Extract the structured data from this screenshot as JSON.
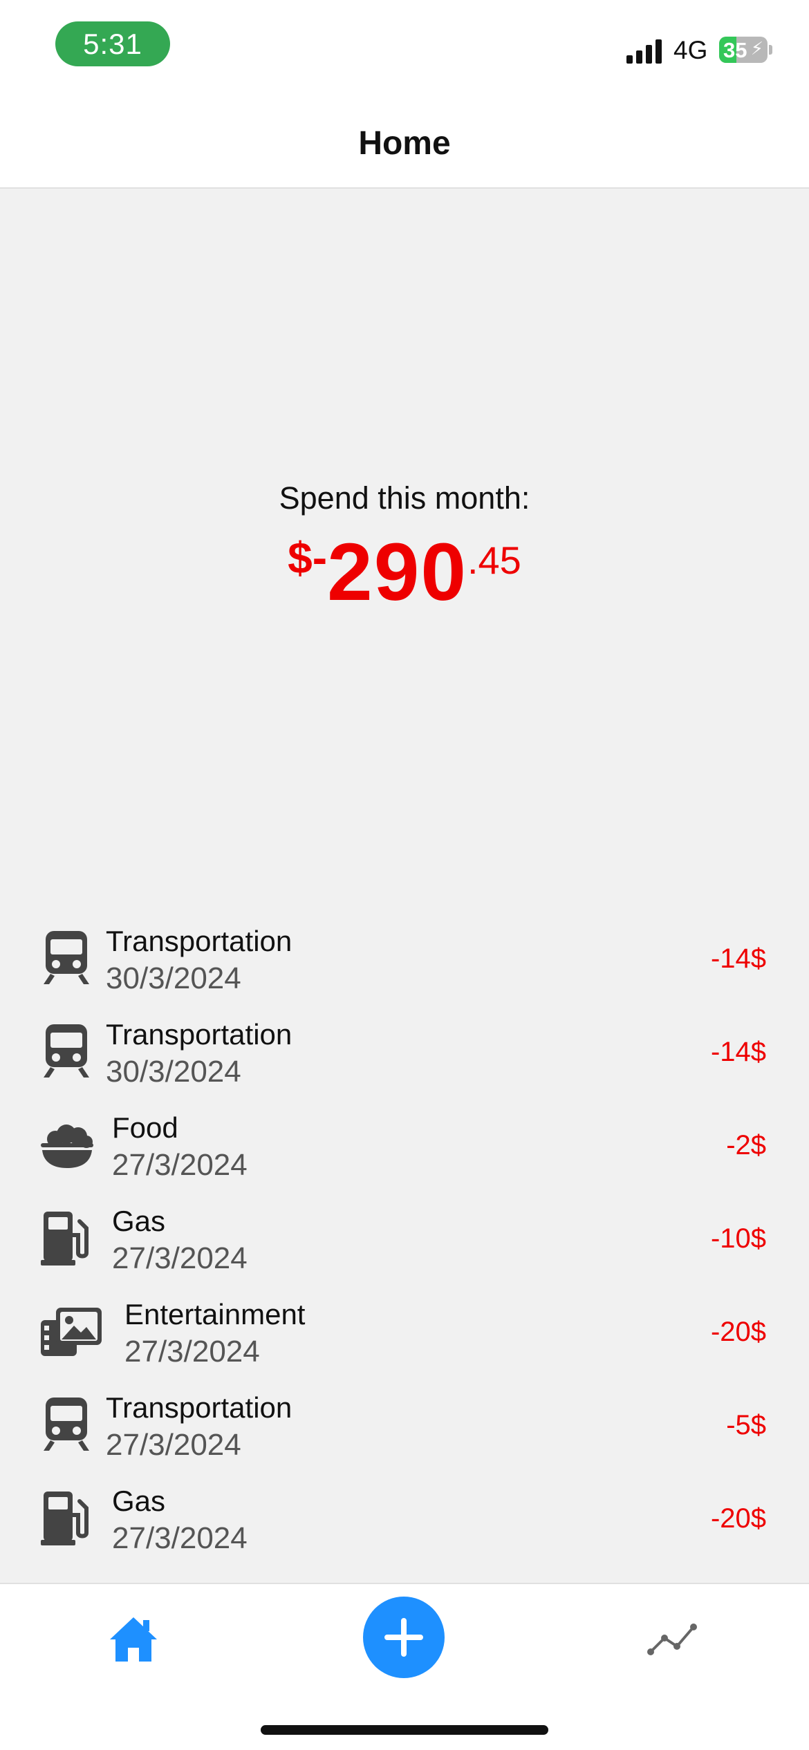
{
  "status_bar": {
    "time": "5:31",
    "network": "4G",
    "battery": "35",
    "battery_level": 0.35
  },
  "nav": {
    "title": "Home"
  },
  "summary": {
    "label": "Spend this month:",
    "prefix": "$-",
    "whole": "290",
    "cents": ".45"
  },
  "transactions": [
    {
      "category": "Transportation",
      "date": "30/3/2024",
      "amount": "-14$",
      "icon": "train-icon"
    },
    {
      "category": "Transportation",
      "date": "30/3/2024",
      "amount": "-14$",
      "icon": "train-icon"
    },
    {
      "category": "Food",
      "date": "27/3/2024",
      "amount": "-2$",
      "icon": "food-bowl-icon"
    },
    {
      "category": "Gas",
      "date": "27/3/2024",
      "amount": "-10$",
      "icon": "gas-pump-icon"
    },
    {
      "category": "Entertainment",
      "date": "27/3/2024",
      "amount": "-20$",
      "icon": "photo-film-icon"
    },
    {
      "category": "Transportation",
      "date": "27/3/2024",
      "amount": "-5$",
      "icon": "train-icon"
    },
    {
      "category": "Gas",
      "date": "27/3/2024",
      "amount": "-20$",
      "icon": "gas-pump-icon"
    }
  ],
  "tab_bar": {
    "home_icon": "home-icon",
    "add_icon": "plus-icon",
    "stats_icon": "chart-line-icon"
  },
  "colors": {
    "accent": "#1e90ff",
    "negative": "#ee0000",
    "time_pill": "#34a853",
    "icon": "#444444"
  }
}
